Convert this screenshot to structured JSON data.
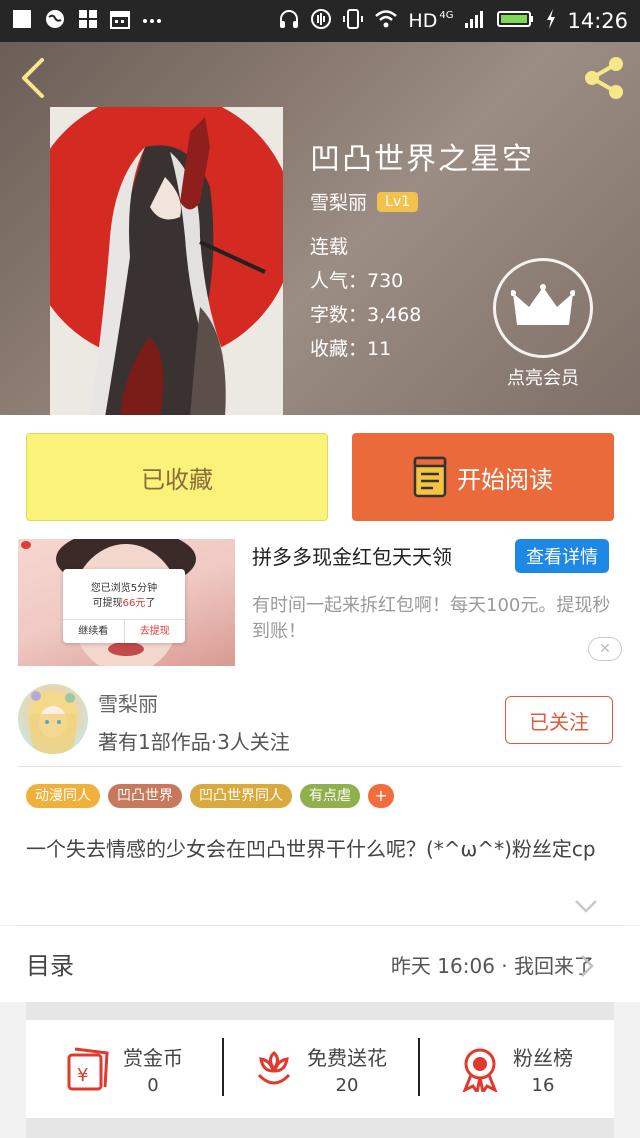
{
  "status_bar": {
    "network": "HD",
    "network_type": "4G",
    "time": "14:26",
    "icons": [
      "notification-icon",
      "globe-icon",
      "apps-icon",
      "calendar-icon",
      "more-icon",
      "headphones-icon",
      "nfc-icon",
      "vibrate-icon",
      "wifi-icon",
      "signal-icon",
      "battery-icon",
      "charging-icon"
    ]
  },
  "header": {
    "title": "凹凸世界之星空",
    "author": "雪梨丽",
    "level": "Lv1",
    "status": "连载",
    "popularity": "人气：730",
    "word_count": "字数：3,468",
    "favorites": "收藏：11",
    "vip_label": "点亮会员"
  },
  "buttons": {
    "favorite": "已收藏",
    "read": "开始阅读"
  },
  "ad": {
    "title": "拼多多现金红包天天领",
    "cta": "查看详情",
    "description": "有时间一起来拆红包啊！每天100元。提现秒到账！",
    "popup_line1": "您已浏览5分钟",
    "popup_line2_prefix": "可提现",
    "popup_amount": "66元",
    "popup_line2_suffix": "了",
    "popup_continue": "继续看",
    "popup_withdraw": "去提现"
  },
  "author_card": {
    "name": "雪梨丽",
    "meta": "著有1部作品·3人关注",
    "follow": "已关注"
  },
  "tags": [
    {
      "label": "动漫同人",
      "color": "#f0b13c"
    },
    {
      "label": "凹凸世界",
      "color": "#c8795c"
    },
    {
      "label": "凹凸世界同人",
      "color": "#d9a93e"
    },
    {
      "label": "有点虐",
      "color": "#8fb04a"
    },
    {
      "label": "+",
      "color": "#f26c3c"
    }
  ],
  "description": "一个失去情感的少女会在凹凸世界干什么呢？(*^ω^*)粉丝定cp",
  "catalog": {
    "label": "目录",
    "latest": "昨天 16:06 · 我回来了"
  },
  "actions": [
    {
      "label": "赏金币",
      "value": "0",
      "icon": "red-envelope-icon"
    },
    {
      "label": "免费送花",
      "value": "20",
      "icon": "flower-icon"
    },
    {
      "label": "粉丝榜",
      "value": "16",
      "icon": "medal-icon"
    }
  ],
  "colors": {
    "accent": "#ea6a3b",
    "favorite_bg": "#fbf27a",
    "ad_button": "#1e88e5",
    "follow": "#e05a3d"
  }
}
